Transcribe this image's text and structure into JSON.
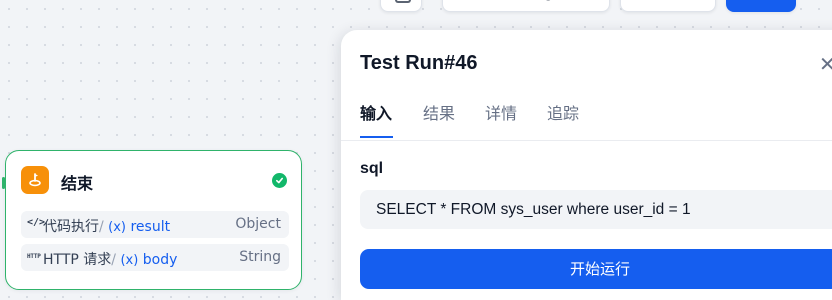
{
  "colors": {
    "primary": "#155eef",
    "success": "#12b76a",
    "node_border": "#2fb36b",
    "node_icon_bg": "#f79009"
  },
  "node": {
    "title": "结束",
    "icon": "end-flag-icon",
    "status_icon": "check-circle-icon",
    "variables": [
      {
        "icon": "code-icon",
        "source": "代码执行",
        "separator": "/",
        "x_marker": "(x)",
        "name": "result",
        "type": "Object"
      },
      {
        "icon": "http-icon",
        "source": "HTTP 请求",
        "separator": "/",
        "x_marker": "(x)",
        "name": "body",
        "type": "String"
      }
    ]
  },
  "panel": {
    "title": "Test Run#46",
    "close_icon": "close-icon",
    "tabs": [
      {
        "label": "输入",
        "active": true
      },
      {
        "label": "结果",
        "active": false
      },
      {
        "label": "详情",
        "active": false
      },
      {
        "label": "追踪",
        "active": false
      }
    ],
    "field": {
      "label": "sql",
      "value": "SELECT * FROM sys_user where user_id = 1"
    },
    "start_button": "开始运行"
  }
}
